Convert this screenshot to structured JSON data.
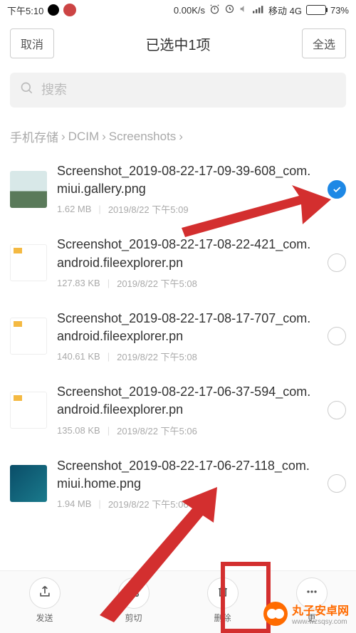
{
  "status": {
    "time": "下午5:10",
    "netspeed": "0.00K/s",
    "carrier": "移动 4G",
    "battery_pct": "73%"
  },
  "header": {
    "cancel": "取消",
    "title": "已选中1项",
    "select_all": "全选"
  },
  "search": {
    "placeholder": "搜索"
  },
  "breadcrumb": {
    "parts": [
      "手机存储",
      "DCIM",
      "Screenshots"
    ]
  },
  "files": [
    {
      "name": "Screenshot_2019-08-22-17-09-39-608_com.miui.gallery.png",
      "size": "1.62 MB",
      "date": "2019/8/22 下午5:09",
      "selected": true,
      "thumb": "landscape"
    },
    {
      "name": "Screenshot_2019-08-22-17-08-22-421_com.android.fileexplorer.pn",
      "size": "127.83 KB",
      "date": "2019/8/22 下午5:08",
      "selected": false,
      "thumb": "white"
    },
    {
      "name": "Screenshot_2019-08-22-17-08-17-707_com.android.fileexplorer.pn",
      "size": "140.61 KB",
      "date": "2019/8/22 下午5:08",
      "selected": false,
      "thumb": "white"
    },
    {
      "name": "Screenshot_2019-08-22-17-06-37-594_com.android.fileexplorer.pn",
      "size": "135.08 KB",
      "date": "2019/8/22 下午5:06",
      "selected": false,
      "thumb": "white"
    },
    {
      "name": "Screenshot_2019-08-22-17-06-27-118_com.miui.home.png",
      "size": "1.94 MB",
      "date": "2019/8/22 下午5:06",
      "selected": false,
      "thumb": "teal"
    }
  ],
  "bottom": {
    "send": "发送",
    "cut": "剪切",
    "delete": "删除",
    "more": "更"
  },
  "watermark": {
    "title": "丸子安卓网",
    "url": "www.wzsqsy.com"
  }
}
